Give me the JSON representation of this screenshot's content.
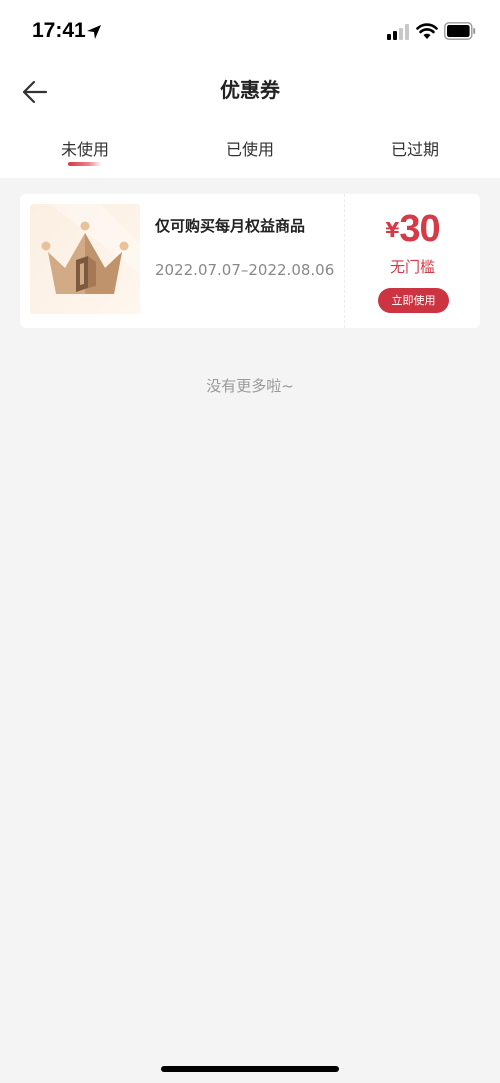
{
  "status_bar": {
    "time": "17:41",
    "icons": [
      "location-arrow-icon",
      "signal-icon",
      "wifi-icon",
      "battery-icon"
    ]
  },
  "nav": {
    "title": "优惠券",
    "back_icon": "back-arrow-icon"
  },
  "tabs": [
    {
      "label": "未使用",
      "active": true
    },
    {
      "label": "已使用",
      "active": false
    },
    {
      "label": "已过期",
      "active": false
    }
  ],
  "coupons": [
    {
      "name": "仅可购买每月权益商品",
      "period": "2022.07.07–2022.08.06",
      "currency": "¥",
      "amount": "30",
      "threshold": "无门槛",
      "action_label": "立即使用",
      "thumbnail_icon": "crown-icon"
    }
  ],
  "footer_text": "没有更多啦~",
  "colors": {
    "accent": "#d43a48",
    "background": "#f4f4f4",
    "card": "#ffffff"
  }
}
